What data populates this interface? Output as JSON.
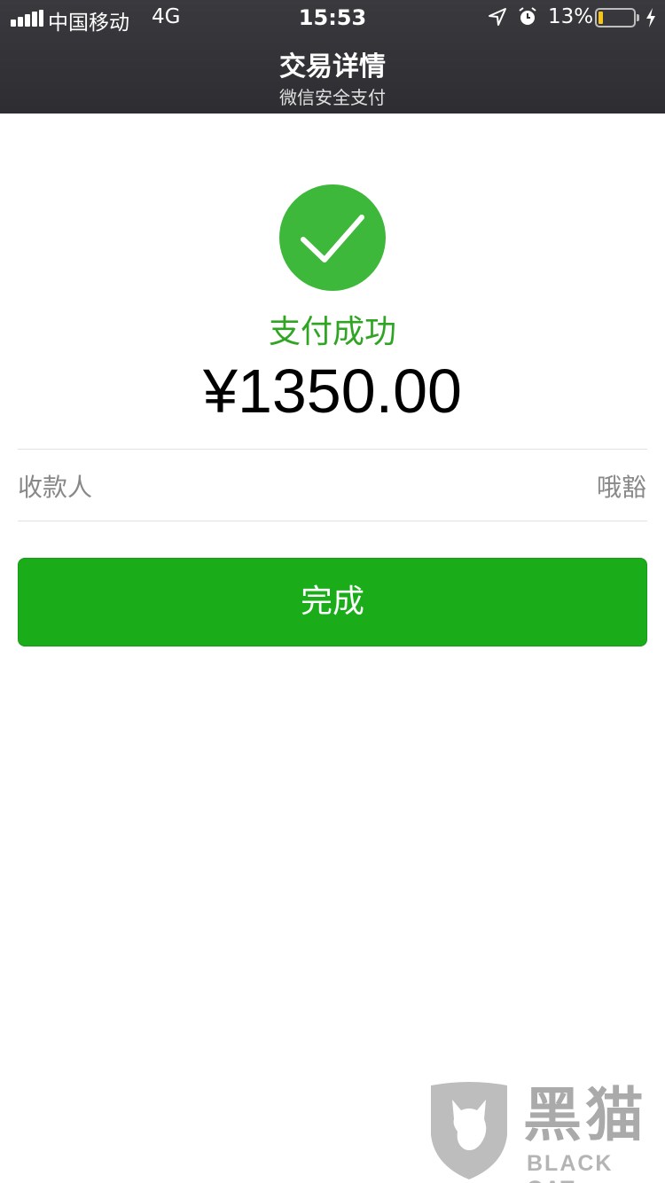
{
  "status_bar": {
    "carrier": "中国移动",
    "network": "4G",
    "time": "15:53",
    "battery_percent": "13%",
    "battery_level": 0.13,
    "icons": [
      "signal-icon",
      "location-arrow-icon",
      "alarm-clock-icon",
      "battery-icon",
      "charging-bolt-icon"
    ]
  },
  "nav": {
    "title": "交易详情",
    "subtitle": "微信安全支付"
  },
  "result": {
    "icon": "checkmark-icon",
    "status": "支付成功",
    "amount": "¥1350.00"
  },
  "details": {
    "payee_label": "收款人",
    "payee_value": "哦豁"
  },
  "actions": {
    "done_label": "完成"
  },
  "watermark": {
    "cn": "黑猫",
    "en": "BLACK CAT"
  },
  "colors": {
    "header_bg": "#333337",
    "success_green": "#3eb83a",
    "status_text_green": "#2fa523",
    "button_green": "#1aad19",
    "muted_text": "#888888"
  }
}
